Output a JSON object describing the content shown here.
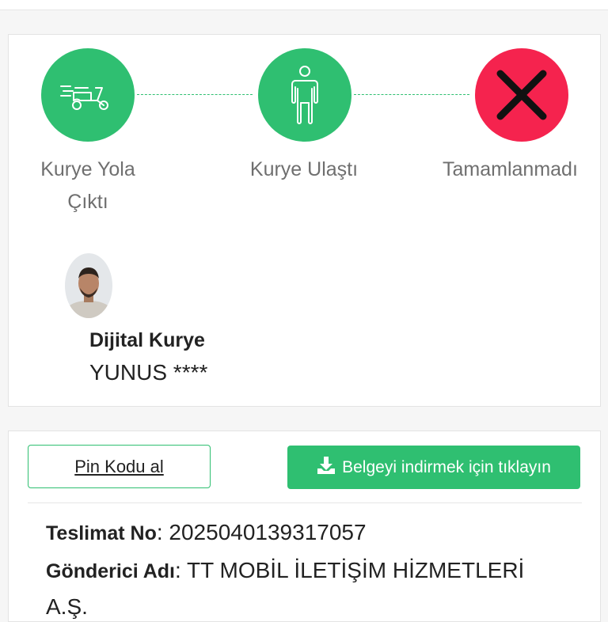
{
  "steps": [
    {
      "label_line1": "Kurye Yola",
      "label_line2": "Çıktı",
      "icon": "scooter-icon",
      "status": "done"
    },
    {
      "label_line1": "Kurye Ulaştı",
      "label_line2": "",
      "icon": "person-icon",
      "status": "done"
    },
    {
      "label_line1": "Tamamlanmadı",
      "label_line2": "",
      "icon": "cross-icon",
      "status": "failed"
    }
  ],
  "courier": {
    "title": "Dijital Kurye",
    "name": "YUNUS ****"
  },
  "actions": {
    "pin_label": "Pin Kodu al",
    "download_label": "Belgeyi indirmek için tıklayın"
  },
  "details": {
    "delivery_no_label": "Teslimat No",
    "delivery_no_value": "2025040139317057",
    "sender_label": "Gönderici Adı",
    "sender_value": "TT MOBİL İLETİŞİM HİZMETLERİ",
    "sender_value_line2": "A.Ş."
  },
  "colors": {
    "accent": "#2fbf71",
    "failed": "#f5234e"
  }
}
